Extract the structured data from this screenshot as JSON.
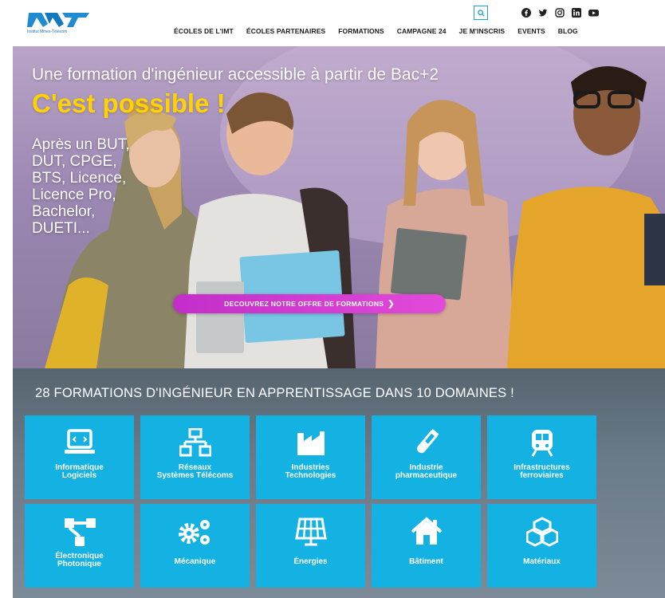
{
  "header": {
    "logo_text": "Institut Mines-Télécom",
    "nav": [
      "ÉCOLES DE L'IMT",
      "ÉCOLES PARTENAIRES",
      "FORMATIONS",
      "CAMPAGNE 24",
      "JE M'INSCRIS",
      "EVENTS",
      "BLOG"
    ],
    "social_icons": [
      "facebook-icon",
      "twitter-icon",
      "instagram-icon",
      "linkedin-icon",
      "youtube-icon"
    ],
    "accent_color": "#18a6d6"
  },
  "hero": {
    "title": "Une formation d'ingénieur accessible à partir de Bac+2",
    "tagline": "C'est possible !",
    "subtitle": "Après un BUT, DUT, CPGE, BTS, Licence, Licence Pro, Bachelor, DUETI...",
    "cta_label": "DECOUVREZ NOTRE OFFRE DE FORMATIONS",
    "cta_color": "#d63bd2",
    "tagline_color": "#ffd200"
  },
  "domains": {
    "title": "28 FORMATIONS D'INGÉNIEUR EN APPRENTISSAGE DANS 10 DOMAINES !",
    "tile_color": "#13b2e2",
    "items": [
      {
        "line1": "Informatique",
        "line2": "Logiciels",
        "icon": "laptop-code-icon"
      },
      {
        "line1": "Réseaux",
        "line2": "Systèmes Télécoms",
        "icon": "network-icon"
      },
      {
        "line1": "Industries",
        "line2": "Technologies",
        "icon": "factory-icon"
      },
      {
        "line1": "Industrie",
        "line2": "pharmaceutique",
        "icon": "flask-icon"
      },
      {
        "line1": "Infrastructures",
        "line2": "ferroviaires",
        "icon": "train-icon"
      },
      {
        "line1": "Électronique",
        "line2": "Photonique",
        "icon": "circuit-icon"
      },
      {
        "line1": "Mécanique",
        "line2": "",
        "icon": "gears-icon"
      },
      {
        "line1": "Énergies",
        "line2": "",
        "icon": "solar-panel-icon"
      },
      {
        "line1": "Bâtiment",
        "line2": "",
        "icon": "house-icon"
      },
      {
        "line1": "Matériaux",
        "line2": "",
        "icon": "cubes-icon"
      }
    ]
  }
}
